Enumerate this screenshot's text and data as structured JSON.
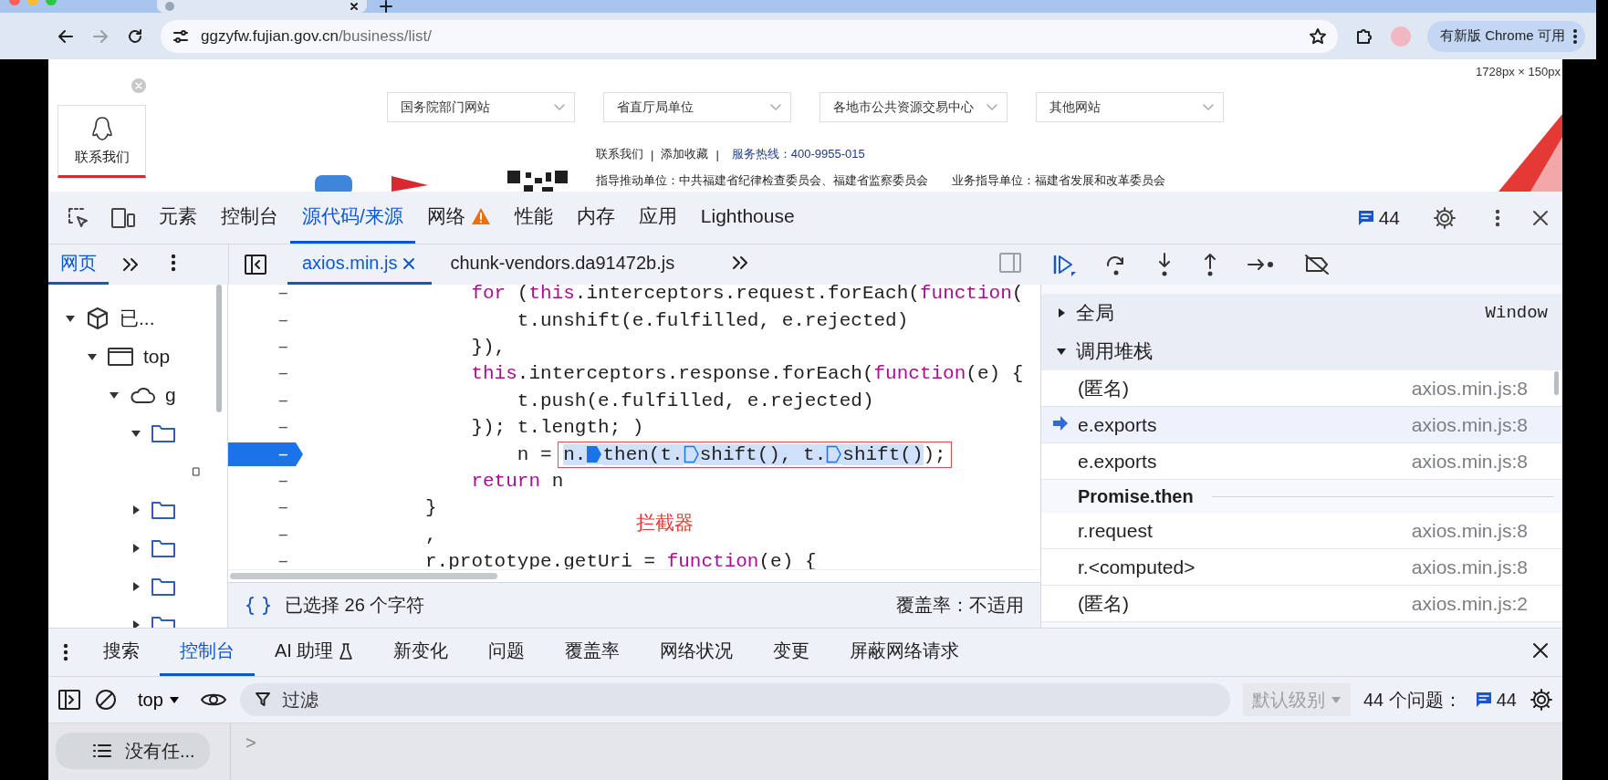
{
  "browser": {
    "url_host": "ggzyfw.fujian.gov.cn",
    "url_path": "/business/list/",
    "update_button": "有新版 Chrome 可用"
  },
  "webpage": {
    "size_overlay": "1728px × 150px",
    "contact_label": "联系我们",
    "dropdowns": [
      "国务院部门网站",
      "省直厅局单位",
      "各地市公共资源交易中心",
      "其他网站"
    ],
    "footer_links": [
      {
        "label": "联系我们",
        "separator": "|"
      },
      {
        "label": "添加收藏",
        "separator": "|"
      }
    ],
    "hotline": "服务热线：400-9955-015",
    "guide_units": "指导推动单位：中共福建省纪律检查委员会、福建省监察委员会",
    "business_units": "业务指导单位：福建省发展和改革委员会"
  },
  "devtools": {
    "tabs": [
      {
        "label": "元素",
        "selected": false,
        "warning": false
      },
      {
        "label": "控制台",
        "selected": false,
        "warning": false
      },
      {
        "label": "源代码/来源",
        "selected": true,
        "warning": false
      },
      {
        "label": "网络",
        "selected": false,
        "warning": true
      },
      {
        "label": "性能",
        "selected": false,
        "warning": false
      },
      {
        "label": "内存",
        "selected": false,
        "warning": false
      },
      {
        "label": "应用",
        "selected": false,
        "warning": false
      },
      {
        "label": "Lighthouse",
        "selected": false,
        "warning": false
      }
    ],
    "messages_count": "44"
  },
  "navigator": {
    "tabs": [
      {
        "label": "网页",
        "selected": true
      }
    ],
    "tree": [
      {
        "kind": "cube",
        "label": "已...",
        "expanded": true,
        "children": [
          {
            "kind": "frame",
            "label": "top",
            "expanded": true,
            "children": [
              {
                "kind": "cloud",
                "label": "g",
                "expanded": true,
                "children": [
                  {
                    "kind": "folder",
                    "expanded": true,
                    "children": [
                      {
                        "kind": "file"
                      }
                    ]
                  },
                  {
                    "kind": "folder",
                    "expanded": false
                  },
                  {
                    "kind": "folder",
                    "expanded": false
                  },
                  {
                    "kind": "folder",
                    "expanded": false
                  },
                  {
                    "kind": "folder",
                    "expanded": false
                  }
                ]
              }
            ]
          }
        ]
      }
    ]
  },
  "editor": {
    "files": [
      {
        "name": "axios.min.js",
        "selected": true,
        "closable": true
      },
      {
        "name": "chunk-vendors.da91472b.js",
        "selected": false,
        "closable": false
      }
    ],
    "lines": [
      {
        "gutter": "–",
        "breakpoint": false,
        "tokens": [
          {
            "text": "    for",
            "kind": "keyword"
          },
          {
            "text": " (",
            "kind": "plain"
          },
          {
            "text": "this",
            "kind": "keyword"
          },
          {
            "text": ".interceptors.request.forEach(",
            "kind": "plain"
          },
          {
            "text": "function",
            "kind": "keyword"
          },
          {
            "text": "(",
            "kind": "plain"
          }
        ]
      },
      {
        "gutter": "–",
        "breakpoint": false,
        "tokens": [
          {
            "text": "        t.unshift(e.fulfilled, e.rejected)",
            "kind": "plain"
          }
        ]
      },
      {
        "gutter": "–",
        "breakpoint": false,
        "tokens": [
          {
            "text": "    }),",
            "kind": "plain"
          }
        ]
      },
      {
        "gutter": "–",
        "breakpoint": false,
        "tokens": [
          {
            "text": "    this",
            "kind": "keyword"
          },
          {
            "text": ".interceptors.response.forEach(",
            "kind": "plain"
          },
          {
            "text": "function",
            "kind": "keyword"
          },
          {
            "text": "(e) {",
            "kind": "plain"
          }
        ]
      },
      {
        "gutter": "–",
        "breakpoint": false,
        "tokens": [
          {
            "text": "        t.push(e.fulfilled, e.rejected)",
            "kind": "plain"
          }
        ]
      },
      {
        "gutter": "–",
        "breakpoint": false,
        "tokens": [
          {
            "text": "    }); t.length; )",
            "kind": "plain"
          }
        ]
      },
      {
        "gutter": "–",
        "breakpoint": true,
        "tokens": [
          {
            "text": "        n = ",
            "kind": "plain"
          }
        ],
        "boxed": [
          {
            "text": "n.",
            "kind": "plain",
            "selected": true
          },
          {
            "kind": "inline-breakpoint",
            "active": true,
            "selected": true
          },
          {
            "text": "then(t.",
            "kind": "plain",
            "selected": true
          },
          {
            "kind": "inline-breakpoint",
            "active": false,
            "selected": true
          },
          {
            "text": "shift(), t.",
            "kind": "plain",
            "selected": true
          },
          {
            "kind": "inline-breakpoint",
            "active": false,
            "selected": true
          },
          {
            "text": "shift()",
            "kind": "plain",
            "selected": true
          },
          {
            "text": ");",
            "kind": "plain",
            "selected": false
          }
        ]
      },
      {
        "gutter": "–",
        "breakpoint": false,
        "tokens": [
          {
            "text": "    return",
            "kind": "keyword"
          },
          {
            "text": " n",
            "kind": "plain"
          }
        ]
      },
      {
        "gutter": "–",
        "breakpoint": false,
        "tokens": [
          {
            "text": "}",
            "kind": "plain"
          }
        ]
      },
      {
        "gutter": "–",
        "breakpoint": false,
        "tokens": [
          {
            "text": ",",
            "kind": "plain"
          }
        ]
      },
      {
        "gutter": "–",
        "breakpoint": false,
        "tokens": [
          {
            "text": "r.prototype.getUri = ",
            "kind": "plain"
          },
          {
            "text": "function",
            "kind": "keyword"
          },
          {
            "text": "(e) {",
            "kind": "plain"
          }
        ]
      }
    ],
    "annotation": "拦截器",
    "selection_status": "已选择 26 个字符",
    "coverage": "覆盖率：不适用"
  },
  "sidebar": {
    "scope": {
      "label": "全局",
      "value": "Window",
      "expanded": false
    },
    "call_stack": {
      "label": "调用堆栈",
      "expanded": true
    },
    "frames": [
      {
        "kind": "frame",
        "name": "(匿名)",
        "location": "axios.min.js:8",
        "selected": false
      },
      {
        "kind": "frame",
        "name": "e.exports",
        "location": "axios.min.js:8",
        "selected": true
      },
      {
        "kind": "frame",
        "name": "e.exports",
        "location": "axios.min.js:8",
        "selected": false
      },
      {
        "kind": "async",
        "name": "Promise.then"
      },
      {
        "kind": "frame",
        "name": "r.request",
        "location": "axios.min.js:8",
        "selected": false
      },
      {
        "kind": "frame",
        "name": "r.<computed>",
        "location": "axios.min.js:8",
        "selected": false
      },
      {
        "kind": "frame",
        "name": "(匿名)",
        "location": "axios.min.js:2",
        "selected": false
      }
    ]
  },
  "drawer": {
    "tabs": [
      {
        "label": "搜索",
        "selected": false,
        "kind": "plain"
      },
      {
        "label": "控制台",
        "selected": true,
        "kind": "plain"
      },
      {
        "label": "AI 助理",
        "selected": false,
        "kind": "experimental"
      },
      {
        "label": "新变化",
        "selected": false,
        "kind": "plain"
      },
      {
        "label": "问题",
        "selected": false,
        "kind": "plain"
      },
      {
        "label": "覆盖率",
        "selected": false,
        "kind": "plain"
      },
      {
        "label": "网络状况",
        "selected": false,
        "kind": "plain"
      },
      {
        "label": "变更",
        "selected": false,
        "kind": "plain"
      },
      {
        "label": "屏蔽网络请求",
        "selected": false,
        "kind": "plain"
      }
    ]
  },
  "console": {
    "context": "top",
    "filter_placeholder": "过滤",
    "level": {
      "label": "默认级别",
      "disabled": true
    },
    "issues_label": "44 个问题：",
    "issues_count": "44",
    "sidebar_item": "没有任...",
    "prompt": ">"
  }
}
